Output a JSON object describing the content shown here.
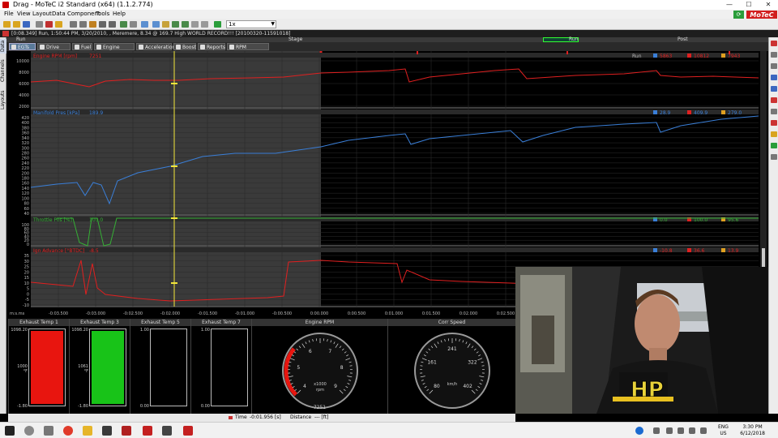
{
  "window": {
    "title": "Drag - MoTeC i2 Standard (x64) (1.1.2.774)",
    "logo": "MoTeC"
  },
  "menu": [
    "File",
    "View",
    "Layout",
    "Data",
    "Component",
    "Tools",
    "Help"
  ],
  "toolbar": {
    "zoom_value": "1x"
  },
  "info": {
    "text": "[0:08.349] Run, 1:50:44 PM, 3/20/2010, , Meremere, 8.34 @ 169.7 High WORLD RECORD!!! [20100320-11591018]"
  },
  "sections": {
    "left": "Run",
    "middle": "Stage",
    "green": "Run",
    "right": "Post"
  },
  "left_tabs": [
    "Data",
    "Channels",
    "Layouts"
  ],
  "worksheet_tabs": [
    {
      "label": "EGTs",
      "active": true
    },
    {
      "label": "Drive Line",
      "active": false
    },
    {
      "label": "Fuel",
      "active": false
    },
    {
      "label": "Engine Health",
      "active": false
    },
    {
      "label": "Acceleration",
      "active": false
    },
    {
      "label": "Boost",
      "active": false
    },
    {
      "label": "Reports",
      "active": false
    },
    {
      "label": "RPM Histogram",
      "active": false
    }
  ],
  "graph": {
    "run_label": "Run",
    "ms_label": "m:s.ms",
    "time_ticks": [
      "-0:03.500",
      "-0:03.000",
      "-0:02.500",
      "-0:02.000",
      "-0:01.500",
      "-0:01.000",
      "-0:00.500",
      "0:00.000",
      "0:00.500",
      "0:01.000",
      "0:01.500",
      "0:02.000",
      "0:02.500"
    ],
    "panes": [
      {
        "name": "Engine RPM [rpm]",
        "cursor": "7251",
        "color": "#e02020",
        "min_label": "5863",
        "max_label": "10812",
        "avg_label": "7943",
        "ticks": [
          "10000",
          "8000",
          "6000",
          "4000",
          "2000"
        ]
      },
      {
        "name": "Manifold Pres [kPa]",
        "cursor": "189.9",
        "color": "#3a7fd8",
        "min_label": "28.9",
        "max_label": "409.9",
        "avg_label": "279.0",
        "ticks": [
          "420",
          "400",
          "380",
          "360",
          "340",
          "320",
          "300",
          "280",
          "260",
          "240",
          "220",
          "200",
          "180",
          "160",
          "140",
          "120",
          "100",
          "80",
          "60",
          "40"
        ]
      },
      {
        "name": "Throttle Pos [%]",
        "cursor": "100.0",
        "color": "#35b035",
        "min_label": "0.0",
        "max_label": "100.0",
        "avg_label": "95.6",
        "ticks": [
          "100",
          "80",
          "60",
          "40",
          "20",
          "0"
        ]
      },
      {
        "name": "Ign Advance [°BTDC]",
        "cursor": "-8.5",
        "color": "#e02020",
        "min_label": "-10.8",
        "max_label": "36.6",
        "avg_label": "13.9",
        "ticks": [
          "35",
          "30",
          "25",
          "20",
          "15",
          "10",
          "5",
          "0",
          "-5",
          "-10"
        ]
      }
    ]
  },
  "gauges": {
    "bars": [
      {
        "title": "Exhaust Temp 1",
        "max": "1098.20",
        "min": "-1.80",
        "value": "1000",
        "unit": "°F",
        "fill_color": "#e8150f",
        "fill_fraction": 1.0
      },
      {
        "title": "Exhaust Temp 3",
        "max": "1098.20",
        "min": "-1.80",
        "value": "1061",
        "unit": "°F",
        "fill_color": "#18c318",
        "fill_fraction": 1.0
      },
      {
        "title": "Exhaust Temp 5",
        "max": "1.00",
        "min": "0.00",
        "value": "",
        "unit": "",
        "fill_color": "#000000",
        "fill_fraction": 0
      },
      {
        "title": "Exhaust Temp 7",
        "max": "1.00",
        "min": "0.00",
        "value": "",
        "unit": "",
        "fill_color": "#000000",
        "fill_fraction": 0
      }
    ],
    "rpm": {
      "title": "Engine RPM",
      "scale": [
        "4",
        "5",
        "6",
        "7",
        "8",
        "9"
      ],
      "unit": "x1000",
      "unit2": "rpm",
      "value": "7251"
    },
    "speed": {
      "title": "Corr Speed",
      "scale": [
        "80",
        "161",
        "241",
        "322",
        "402"
      ],
      "unit": "km/h"
    }
  },
  "status": {
    "time_label": "Time",
    "time_value": "-0:01.956 [s]",
    "distance_label": "Distance",
    "distance_value": "--- [ft]"
  },
  "taskbar": {
    "lang": "ENG",
    "region": "US",
    "time": "3:30 PM",
    "date": "6/12/2018"
  },
  "webcam": {
    "hoodie_text": "HP"
  }
}
